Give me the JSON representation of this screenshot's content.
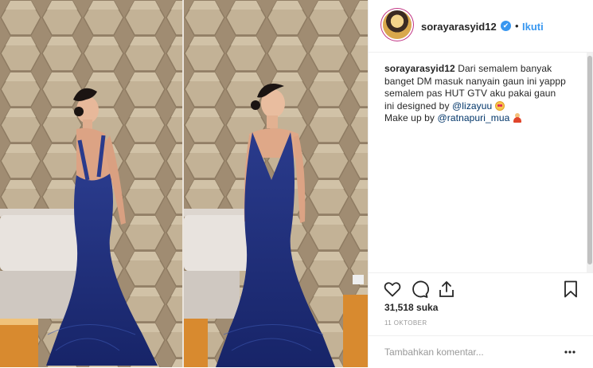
{
  "post": {
    "username": "sorayarasyid12",
    "verified_badge": "✔",
    "separator": "•",
    "follow_label": "Ikuti",
    "avatar": "profile-avatar"
  },
  "caption": {
    "author": "sorayarasyid12",
    "line_text": "Dari semalem banyak banget DM masuk nanyain gaun ini yappp semalem pas HUT GTV aku pakai gaun ini designed by",
    "mention_1": "@lizayuu",
    "makeup_text": "Make up by",
    "mention_2": "@ratnapuri_mua"
  },
  "actions": {
    "like_icon": "heart-icon",
    "comment_icon": "comment-icon",
    "share_icon": "share-icon",
    "save_icon": "bookmark-icon"
  },
  "likes_text": "31,518 suka",
  "date_text": "11 OKTOBER",
  "comment": {
    "placeholder": "Tambahkan komentar...",
    "more_icon": "ellipsis-icon"
  },
  "colors": {
    "link_blue": "#3897f0",
    "mention": "#003569",
    "text": "#262626",
    "muted": "#999999",
    "dress": "#1f2f7a"
  }
}
